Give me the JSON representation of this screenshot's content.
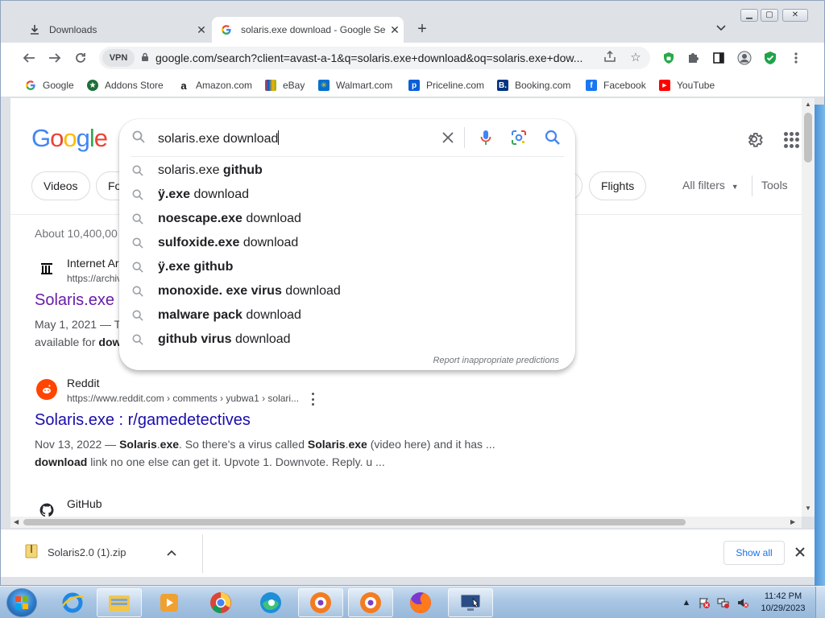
{
  "browser": {
    "tabs": [
      {
        "title": "Downloads",
        "icon": "download-icon",
        "active": false
      },
      {
        "title": "solaris.exe download - Google Se",
        "icon": "google-g-icon",
        "active": true
      }
    ],
    "vpn_label": "VPN",
    "url": "google.com/search?client=avast-a-1&q=solaris.exe+download&oq=solaris.exe+dow...",
    "bookmarks": [
      {
        "label": "Google",
        "icon": "google-g-icon"
      },
      {
        "label": "Addons Store",
        "icon": "addons-store-icon"
      },
      {
        "label": "Amazon.com",
        "icon": "amazon-icon"
      },
      {
        "label": "eBay",
        "icon": "ebay-icon"
      },
      {
        "label": "Walmart.com",
        "icon": "walmart-icon"
      },
      {
        "label": "Priceline.com",
        "icon": "priceline-icon"
      },
      {
        "label": "Booking.com",
        "icon": "booking-icon"
      },
      {
        "label": "Facebook",
        "icon": "facebook-icon"
      },
      {
        "label": "YouTube",
        "icon": "youtube-icon"
      }
    ]
  },
  "google": {
    "logo": "Google",
    "chips": [
      "Videos",
      "Fo",
      "Flights"
    ],
    "all_filters": "All filters",
    "tools": "Tools",
    "search": {
      "query": "solaris.exe download",
      "suggestions": [
        {
          "normal": "solaris.exe ",
          "bold": "github",
          "bold_first": false
        },
        {
          "normal": " download",
          "bold": "ÿ.exe",
          "bold_first": true
        },
        {
          "normal": " download",
          "bold": "noescape.exe",
          "bold_first": true
        },
        {
          "normal": " download",
          "bold": "sulfoxide.exe",
          "bold_first": true
        },
        {
          "normal": "",
          "bold": "ÿ.exe github",
          "bold_first": true
        },
        {
          "normal": " download",
          "bold": "monoxide. exe virus",
          "bold_first": true
        },
        {
          "normal": " download",
          "bold": "malware pack",
          "bold_first": true
        },
        {
          "normal": " download",
          "bold": "github virus",
          "bold_first": true
        }
      ],
      "report_text": "Report inappropriate predictions"
    },
    "stats": "About 10,400,00",
    "results": [
      {
        "site": "Internet Ar",
        "url": "https://archiv",
        "title": "Solaris.exe",
        "snippet_line1": "May 1, 2021 — T",
        "snippet_line2_normal": "available for ",
        "snippet_line2_bold": "dow"
      },
      {
        "site": "Reddit",
        "url": "https://www.reddit.com › comments › yubwa1 › solari...",
        "title": "Solaris.exe : r/gamedetectives",
        "s1_a": "Nov 13, 2022 — ",
        "s1_b": "Solaris",
        "s1_c": ".",
        "s1_d": "exe",
        "s1_e": ". So there's a virus called ",
        "s1_f": "Solaris",
        "s1_g": ".",
        "s1_h": "exe",
        "s1_i": " (video here) and it has ...",
        "s2_a": "download",
        "s2_b": " link no one else can get it. Upvote 1. Downvote. Reply. u ..."
      },
      {
        "site": "GitHub"
      }
    ]
  },
  "download_bar": {
    "file": "Solaris2.0 (1).zip",
    "show_all": "Show all"
  },
  "taskbar": {
    "time": "11:42 PM",
    "date": "10/29/2023"
  },
  "colors": {
    "link": "#1a0dab",
    "visited": "#681da8",
    "google_blue": "#4285f4",
    "google_red": "#ea4335",
    "google_yellow": "#fbbc05",
    "google_green": "#34a853"
  }
}
